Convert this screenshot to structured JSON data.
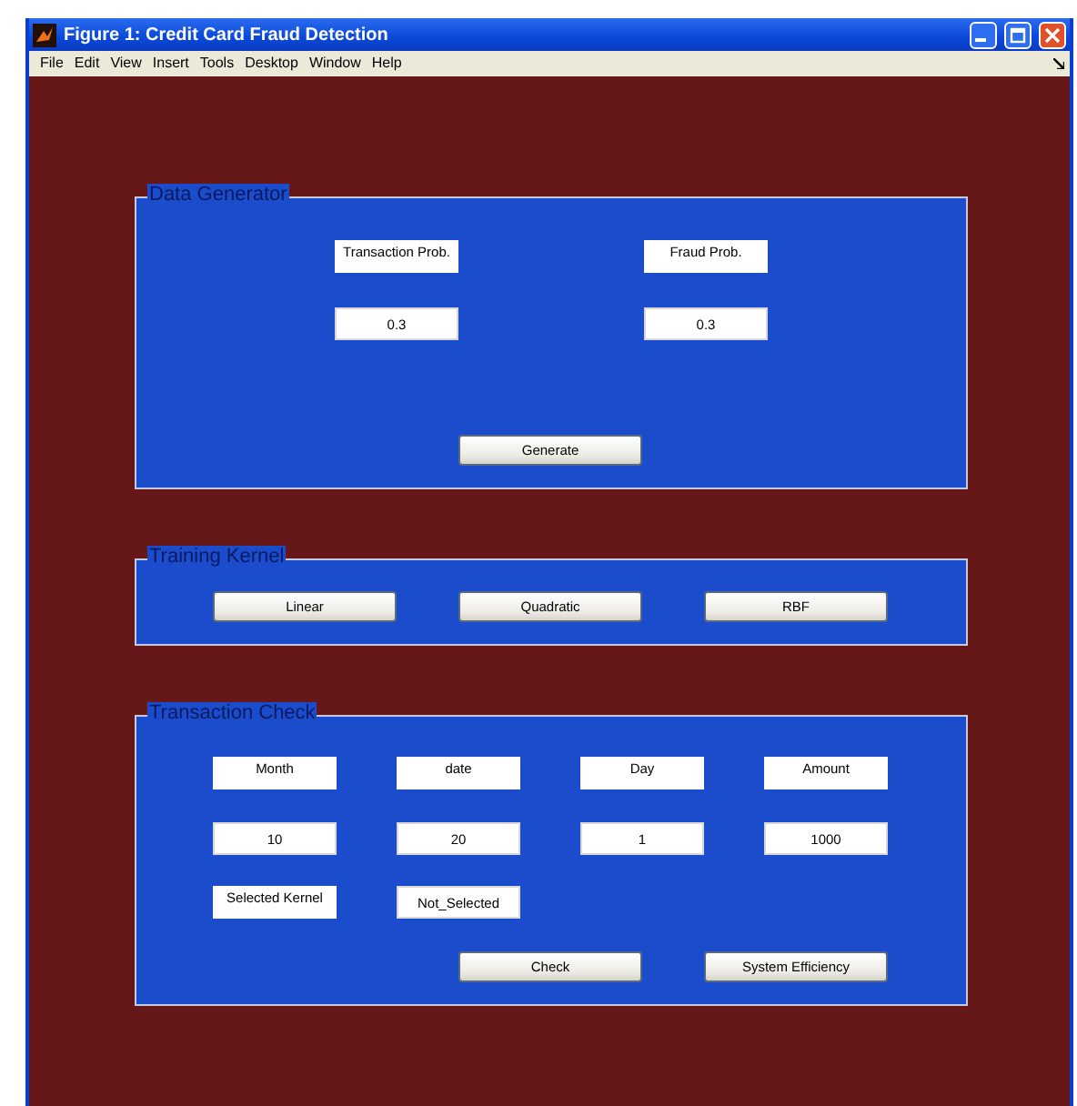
{
  "window": {
    "title": "Figure 1: Credit Card Fraud Detection"
  },
  "menu": [
    "File",
    "Edit",
    "View",
    "Insert",
    "Tools",
    "Desktop",
    "Window",
    "Help"
  ],
  "data_generator": {
    "title": "Data Generator",
    "labels": [
      "Transaction Prob.",
      "Fraud Prob."
    ],
    "values": [
      "0.3",
      "0.3"
    ],
    "button": "Generate"
  },
  "training_kernel": {
    "title": "Training Kernel",
    "buttons": [
      "Linear",
      "Quadratic",
      "RBF"
    ]
  },
  "transaction_check": {
    "title": "Transaction Check",
    "labels": [
      "Month",
      "date",
      "Day",
      "Amount"
    ],
    "values": [
      "10",
      "20",
      "1",
      "1000"
    ],
    "kernel_label": "Selected Kernel",
    "kernel_value": "Not_Selected",
    "buttons": [
      "Check",
      "System Efficiency"
    ]
  }
}
